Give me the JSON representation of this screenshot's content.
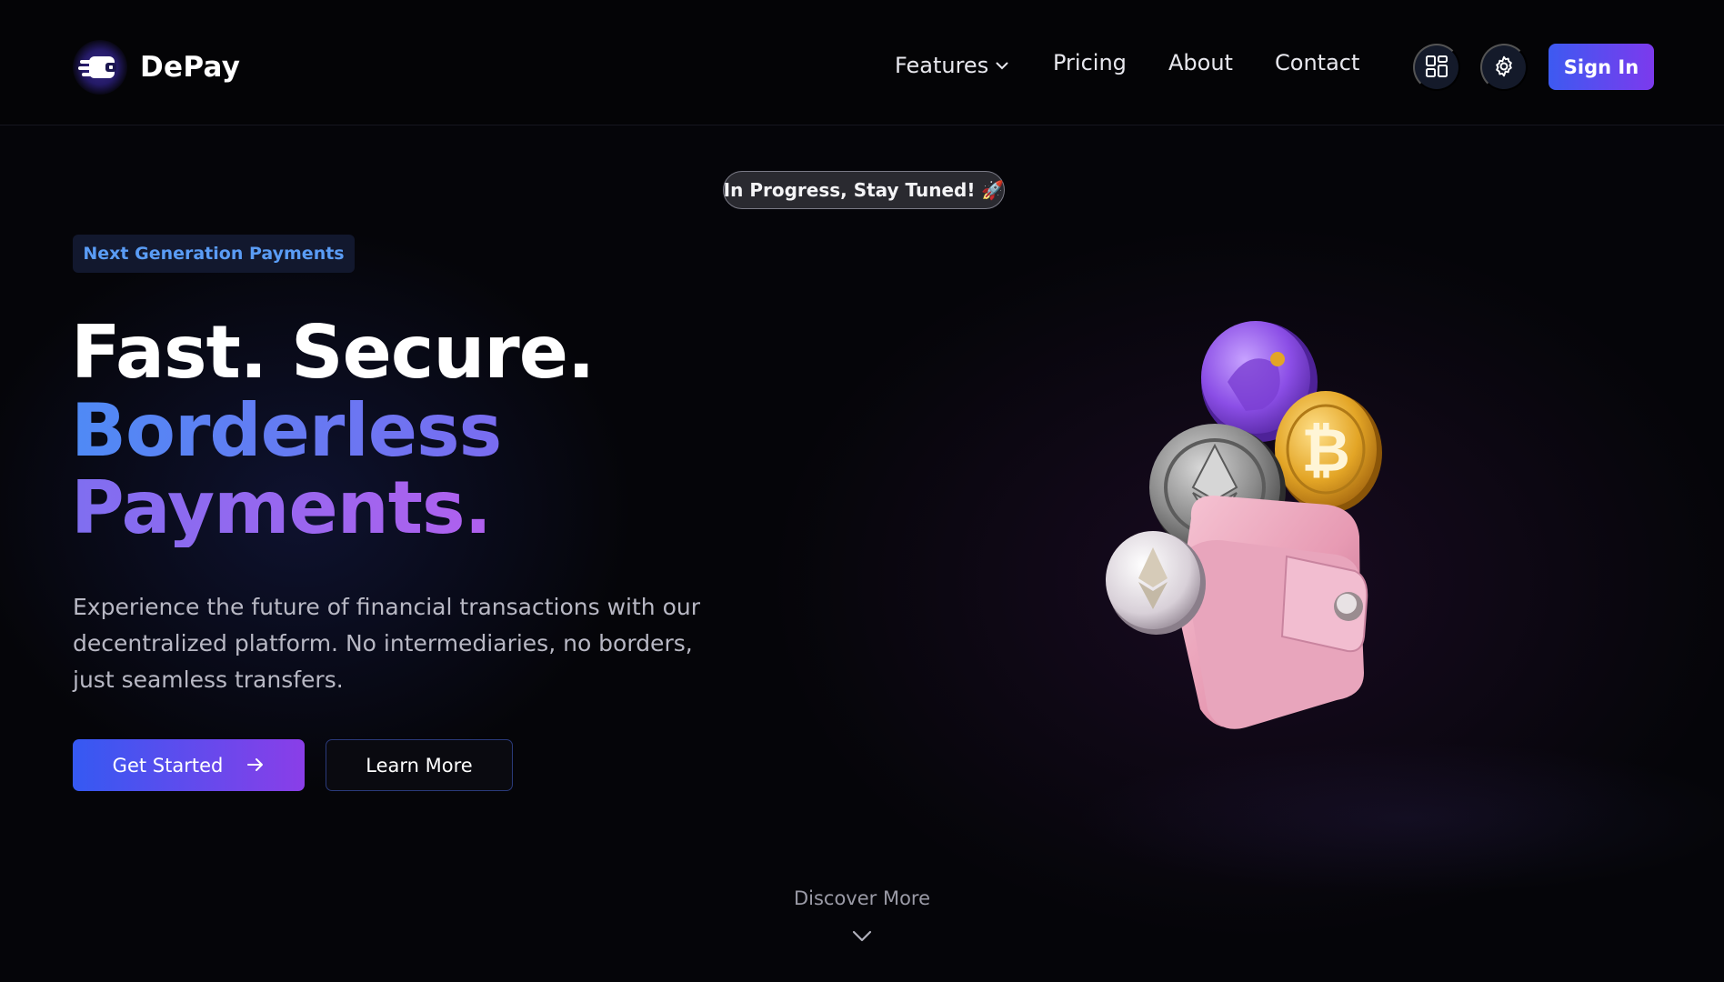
{
  "brand": {
    "name": "DePay"
  },
  "nav": {
    "links": [
      {
        "label": "Features",
        "has_dropdown": true
      },
      {
        "label": "Pricing"
      },
      {
        "label": "About"
      },
      {
        "label": "Contact"
      }
    ],
    "sign_in_label": "Sign In",
    "icons": [
      "grid-icon",
      "gear-icon"
    ]
  },
  "hero": {
    "status_pill": "In Progress, Stay Tuned! 🚀",
    "tag": "Next Generation Payments",
    "headline": {
      "line1": "Fast. Secure.",
      "line2": "Borderless",
      "line3": "Payments."
    },
    "description": [
      "Experience the future of financial transactions with our",
      "decentralized platform. No intermediaries, no borders,",
      "just seamless transfers."
    ],
    "primary_cta": "Get Started",
    "secondary_cta": "Learn More",
    "discover": "Discover More"
  },
  "colors": {
    "accent_blue": "#3d5af1",
    "accent_purple": "#7c3aed",
    "background": "#050509",
    "tag_text": "#5a9cf5"
  }
}
